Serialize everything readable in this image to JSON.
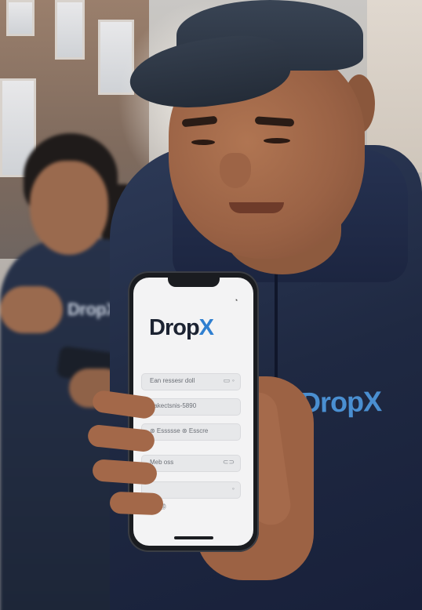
{
  "scene": {
    "jacket_logo": "DropX",
    "background_jacket_logo": "DropX"
  },
  "phone_screen": {
    "logo_main": "Drop",
    "logo_accent": "X",
    "fields": [
      {
        "text": "Ean ressesr doll",
        "icon": "▭ ◦"
      },
      {
        "text": "Pakectsnis-5890",
        "icon": ""
      },
      {
        "text": "⊛ Essssse    ⊛ Esscre",
        "icon": ""
      },
      {
        "text": "Meb oss",
        "icon": "⊂⊃"
      },
      {
        "text": "",
        "icon": "◦"
      },
      {
        "text": "● ⸰ ㊞",
        "icon": ""
      }
    ]
  },
  "colors": {
    "brand_blue": "#2f7fd0",
    "jacket_navy": "#1f2942"
  }
}
